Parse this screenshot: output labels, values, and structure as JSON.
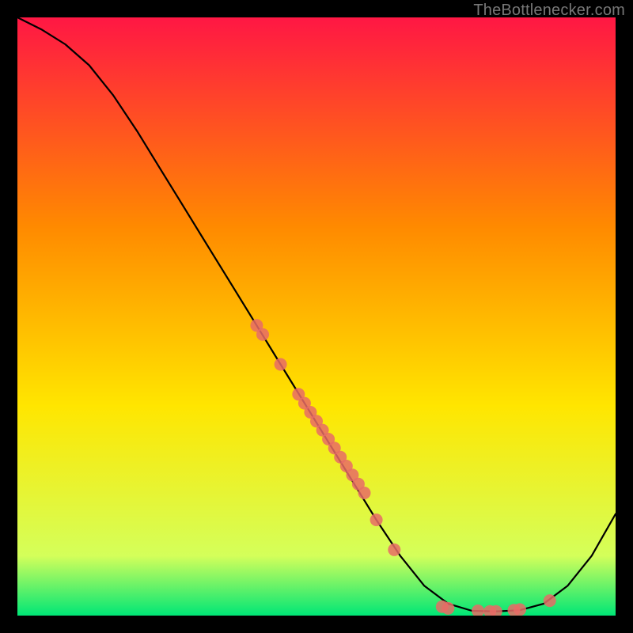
{
  "attribution": "TheBottlenecker.com",
  "colors": {
    "gradient_top": "#ff1744",
    "gradient_mid1": "#ff8a00",
    "gradient_mid2": "#ffe600",
    "gradient_mid3": "#d4ff5a",
    "gradient_bottom": "#00e676",
    "curve": "#000000",
    "marker": "#e86b66",
    "frame_bg": "#000000"
  },
  "chart_data": {
    "type": "line",
    "title": "",
    "xlabel": "",
    "ylabel": "",
    "xlim": [
      0,
      100
    ],
    "ylim": [
      0,
      100
    ],
    "curve": {
      "x": [
        0,
        4,
        8,
        12,
        16,
        20,
        24,
        28,
        32,
        36,
        40,
        44,
        48,
        52,
        56,
        60,
        64,
        68,
        72,
        76,
        80,
        84,
        88,
        92,
        96,
        100
      ],
      "y": [
        100,
        98,
        95.5,
        92,
        87,
        81,
        74.5,
        68,
        61.5,
        55,
        48.5,
        42,
        35.5,
        29,
        22.5,
        16,
        10,
        5,
        2,
        0.8,
        0.7,
        0.9,
        2,
        5,
        10,
        17
      ]
    },
    "markers": {
      "x": [
        40,
        41,
        44,
        47,
        48,
        49,
        50,
        51,
        52,
        53,
        54,
        55,
        56,
        57,
        58,
        60,
        63,
        71,
        72,
        77,
        79,
        80,
        83,
        84,
        89
      ],
      "y": [
        48.5,
        47,
        42,
        37,
        35.5,
        34,
        32.5,
        31,
        29.5,
        28,
        26.5,
        25,
        23.5,
        22,
        20.5,
        16,
        11,
        1.5,
        1.2,
        0.8,
        0.7,
        0.7,
        0.9,
        1.0,
        2.5
      ]
    }
  }
}
